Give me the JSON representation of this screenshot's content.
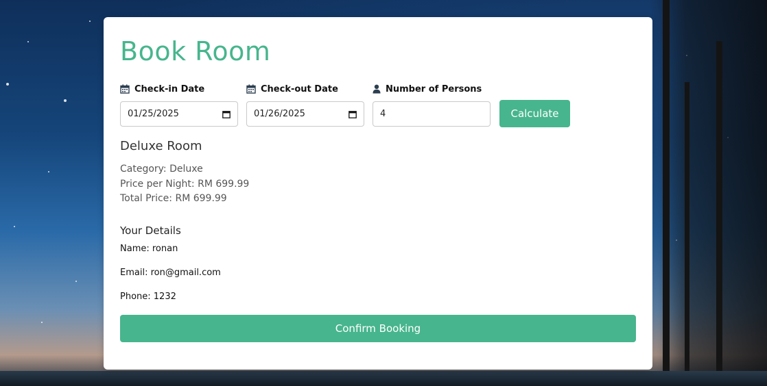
{
  "form": {
    "title": "Book Room",
    "checkin": {
      "label": "Check-in Date",
      "value": "01/25/2025",
      "icon": "calendar-icon"
    },
    "checkout": {
      "label": "Check-out Date",
      "value": "01/26/2025",
      "icon": "calendar-icon"
    },
    "persons": {
      "label": "Number of Persons",
      "value": "4",
      "icon": "user-icon"
    },
    "calculate_label": "Calculate"
  },
  "room": {
    "name": "Deluxe Room",
    "category": "Category: Deluxe",
    "price_per_night": "Price per Night: RM 699.99",
    "total_price": "Total Price: RM 699.99"
  },
  "details": {
    "title": "Your Details",
    "name": "Name: ronan",
    "email": "Email: ron@gmail.com",
    "phone": "Phone: 1232"
  },
  "confirm_label": "Confirm Booking",
  "colors": {
    "accent": "#47b58e",
    "card_background": "#ffffff"
  }
}
